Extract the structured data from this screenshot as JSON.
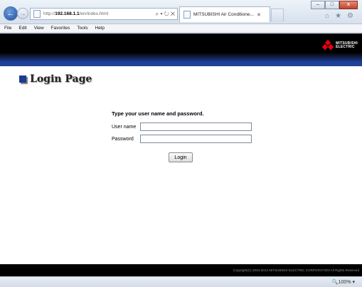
{
  "browser": {
    "address_prefix": "http://",
    "address_host": "192.168.1.1",
    "address_path": "/en/index.html",
    "address_tools": "⌕ ▾ ↻ ✕",
    "tab_label": "MITSUBISHI Air Conditione...",
    "tab_close": "✕",
    "window_controls": {
      "minimize": "–",
      "maximize": "□",
      "close": "x"
    },
    "toolbar_icons": {
      "home": "⌂",
      "favorites": "★",
      "settings": "⚙"
    },
    "back_glyph": "←",
    "forward_glyph": "→"
  },
  "menu": [
    "File",
    "Edit",
    "View",
    "Favorites",
    "Tools",
    "Help"
  ],
  "brand": {
    "line1": "MITSUBISHI",
    "line2": "ELECTRIC",
    "color": "#e60012"
  },
  "page": {
    "title": "Login Page",
    "prompt": "Type your user name and password.",
    "username_label": "User name",
    "username_value": "",
    "password_label": "Password",
    "password_value": "",
    "login_button": "Login",
    "copyright": "Copyright(C) 2004-2013 MITSUBISHI ELECTRIC CORPORATION All Rights Reserved"
  },
  "status": {
    "zoom": "🔍100%  ▾"
  }
}
